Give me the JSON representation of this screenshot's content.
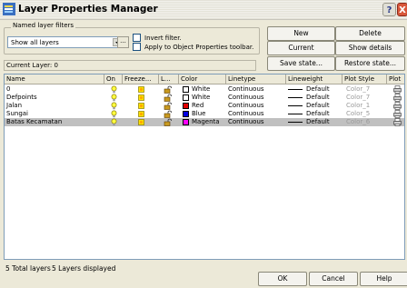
{
  "window": {
    "title": "Layer Properties Manager",
    "help_glyph": "?",
    "close_glyph": "X"
  },
  "filters": {
    "group_label": "Named layer filters",
    "selected": "Show all layers",
    "more_button": "...",
    "invert_label": "Invert filter.",
    "apply_label": "Apply to Object Properties toolbar."
  },
  "buttons": {
    "new": "New",
    "delete": "Delete",
    "current": "Current",
    "show_details": "Show details",
    "save_state": "Save state...",
    "restore_state": "Restore state...",
    "ok": "OK",
    "cancel": "Cancel",
    "help": "Help"
  },
  "current_layer": "Current Layer:  0",
  "columns": [
    "Name",
    "On",
    "Freeze...",
    "L...",
    "Color",
    "Linetype",
    "Lineweight",
    "Plot Style",
    "Plot"
  ],
  "layers": [
    {
      "name": "0",
      "color": "White",
      "color_hex": "#ffffff",
      "linetype": "Continuous",
      "lineweight": "Default",
      "plot_style": "Color_7",
      "selected": false
    },
    {
      "name": "Defpoints",
      "color": "White",
      "color_hex": "#ffffff",
      "linetype": "Continuous",
      "lineweight": "Default",
      "plot_style": "Color_7",
      "selected": false
    },
    {
      "name": "Jalan",
      "color": "Red",
      "color_hex": "#e00000",
      "linetype": "Continuous",
      "lineweight": "Default",
      "plot_style": "Color_1",
      "selected": false
    },
    {
      "name": "Sungai",
      "color": "Blue",
      "color_hex": "#0000e0",
      "linetype": "Continuous",
      "lineweight": "Default",
      "plot_style": "Color_5",
      "selected": false
    },
    {
      "name": "Batas Kecamatan",
      "color": "Magenta",
      "color_hex": "#ff00ff",
      "linetype": "Continuous",
      "lineweight": "Default",
      "plot_style": "Color_6",
      "selected": true
    }
  ],
  "status": {
    "total": "5 Total layers",
    "displayed": "5 Layers displayed"
  },
  "icons": {
    "on": "lightbulb-icon",
    "freeze": "sun-icon",
    "lock": "padlock-open-icon",
    "plot": "printer-icon"
  }
}
